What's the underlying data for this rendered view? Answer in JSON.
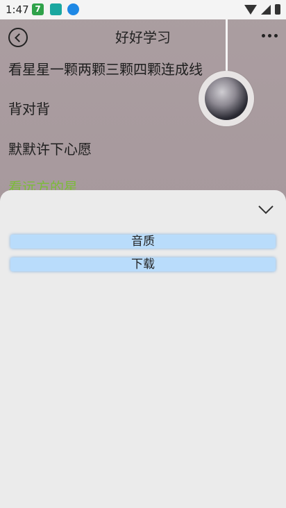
{
  "status_bar": {
    "time": "1:47",
    "icons": [
      "app-7-icon",
      "robot-app-icon",
      "download-icon",
      "wifi-icon",
      "signal-icon",
      "battery-icon"
    ],
    "app_badge": "7"
  },
  "header": {
    "title": "好好学习"
  },
  "lyrics": [
    "看星星一颗两颗三颗四颗连成线",
    "背对背",
    "默默许下心愿",
    "看远方的星"
  ],
  "sheet": {
    "buttons": [
      "音质",
      "下载"
    ]
  },
  "colors": {
    "highlight_lyric": "#7dbb3b",
    "sheet_button_bg": "#b9dcfb",
    "sheet_bg": "#ebebeb"
  }
}
